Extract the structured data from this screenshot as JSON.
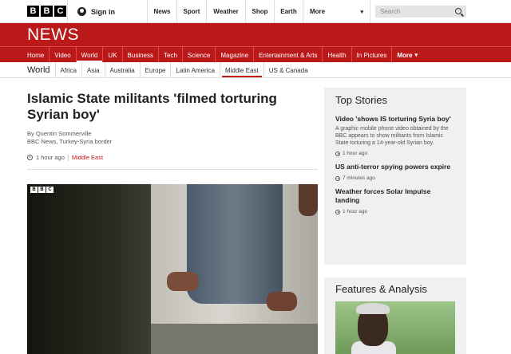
{
  "header": {
    "logo_letters": [
      "B",
      "B",
      "C"
    ],
    "signin_label": "Sign in",
    "nav": [
      "News",
      "Sport",
      "Weather",
      "Shop",
      "Earth",
      "More"
    ],
    "search_placeholder": "Search"
  },
  "banner": {
    "title": "NEWS"
  },
  "section_nav": {
    "items": [
      "Home",
      "Video",
      "World",
      "UK",
      "Business",
      "Tech",
      "Science",
      "Magazine",
      "Entertainment & Arts",
      "Health",
      "In Pictures",
      "More"
    ],
    "active": "World"
  },
  "sub_nav": {
    "title": "World",
    "items": [
      "Africa",
      "Asia",
      "Australia",
      "Europe",
      "Latin America",
      "Middle East",
      "US & Canada"
    ],
    "active": "Middle East"
  },
  "article": {
    "headline": "Islamic State militants 'filmed torturing Syrian boy'",
    "author": "By Quentin Sommerville",
    "author_role": "BBC News, Turkey-Syria border",
    "time": "1 hour ago",
    "section": "Middle East",
    "video_logo": [
      "B",
      "B",
      "C"
    ]
  },
  "top_stories": {
    "title": "Top Stories",
    "stories": [
      {
        "title": "Video 'shows IS torturing Syria boy'",
        "summary": "A graphic mobile phone video obtained by the BBC appears to show militants from Islamic State torturing a 14-year-old Syrian boy.",
        "time": "1 hour ago"
      },
      {
        "title": "US anti-terror spying powers expire",
        "time": "7 minutes ago"
      },
      {
        "title": "Weather forces Solar Impulse landing",
        "time": "1 hour ago"
      }
    ]
  },
  "features": {
    "title": "Features & Analysis"
  },
  "colors": {
    "brand_red": "#bb1919",
    "panel_grey": "#f0f0f0"
  }
}
